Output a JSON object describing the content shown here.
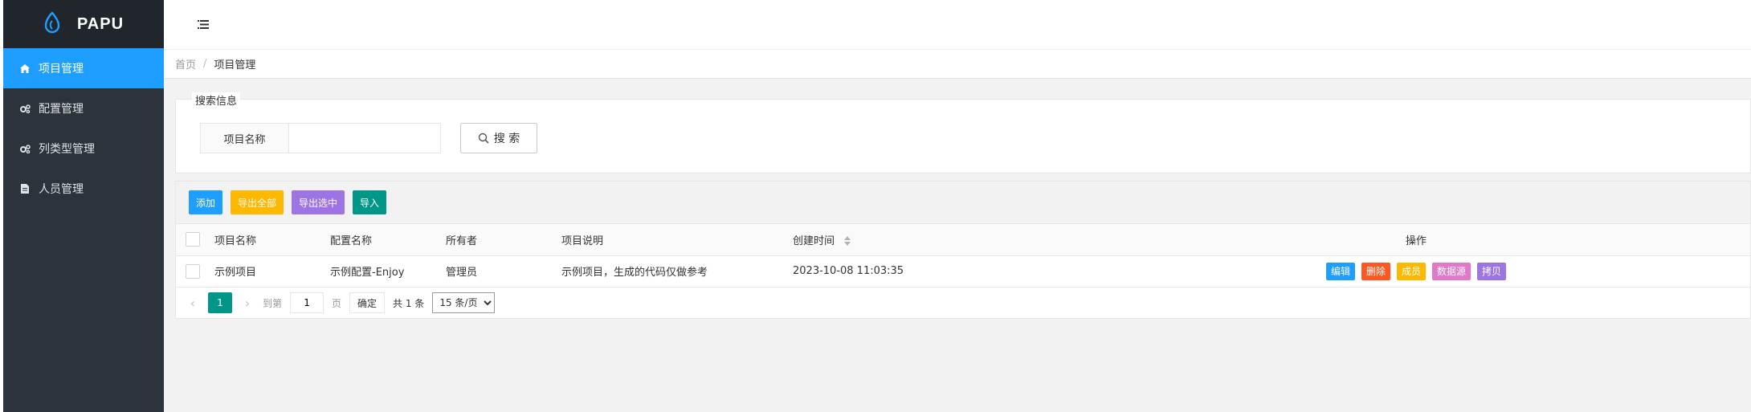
{
  "brand": {
    "name": "PAPU"
  },
  "sidebar": {
    "items": [
      {
        "label": "项目管理",
        "icon": "home-icon",
        "active": true
      },
      {
        "label": "配置管理",
        "icon": "gears-icon",
        "active": false
      },
      {
        "label": "列类型管理",
        "icon": "gears-icon",
        "active": false
      },
      {
        "label": "人员管理",
        "icon": "file-icon",
        "active": false
      }
    ]
  },
  "topbar": {
    "menu_icon": "menu-toggle-icon"
  },
  "breadcrumb": {
    "home": "首页",
    "separator": "/",
    "current": "项目管理"
  },
  "search": {
    "legend": "搜索信息",
    "field_label": "项目名称",
    "field_value": "",
    "button_label": "搜 索"
  },
  "toolbar": {
    "add": "添加",
    "export_all": "导出全部",
    "export_selected": "导出选中",
    "import": "导入"
  },
  "table": {
    "columns": [
      "项目名称",
      "配置名称",
      "所有者",
      "项目说明",
      "创建时间",
      "操作"
    ],
    "rows": [
      {
        "name": "示例项目",
        "config": "示例配置-Enjoy",
        "owner": "管理员",
        "description": "示例项目，生成的代码仅做参考",
        "created": "2023-10-08 11:03:35"
      }
    ],
    "actions": [
      "编辑",
      "删除",
      "成员",
      "数据源",
      "拷贝"
    ]
  },
  "pagination": {
    "current_page": "1",
    "goto_label": "到第",
    "goto_value": "1",
    "page_unit": "页",
    "confirm": "确定",
    "total": "共 1 条",
    "page_size": "15 条/页"
  },
  "colors": {
    "sidebar_bg": "#2c333b",
    "accent_blue": "#1e9fff",
    "yellow": "#ffb800",
    "purple": "#9e74e5",
    "green": "#009688",
    "red": "#ff5722",
    "pink": "#e079c8"
  }
}
